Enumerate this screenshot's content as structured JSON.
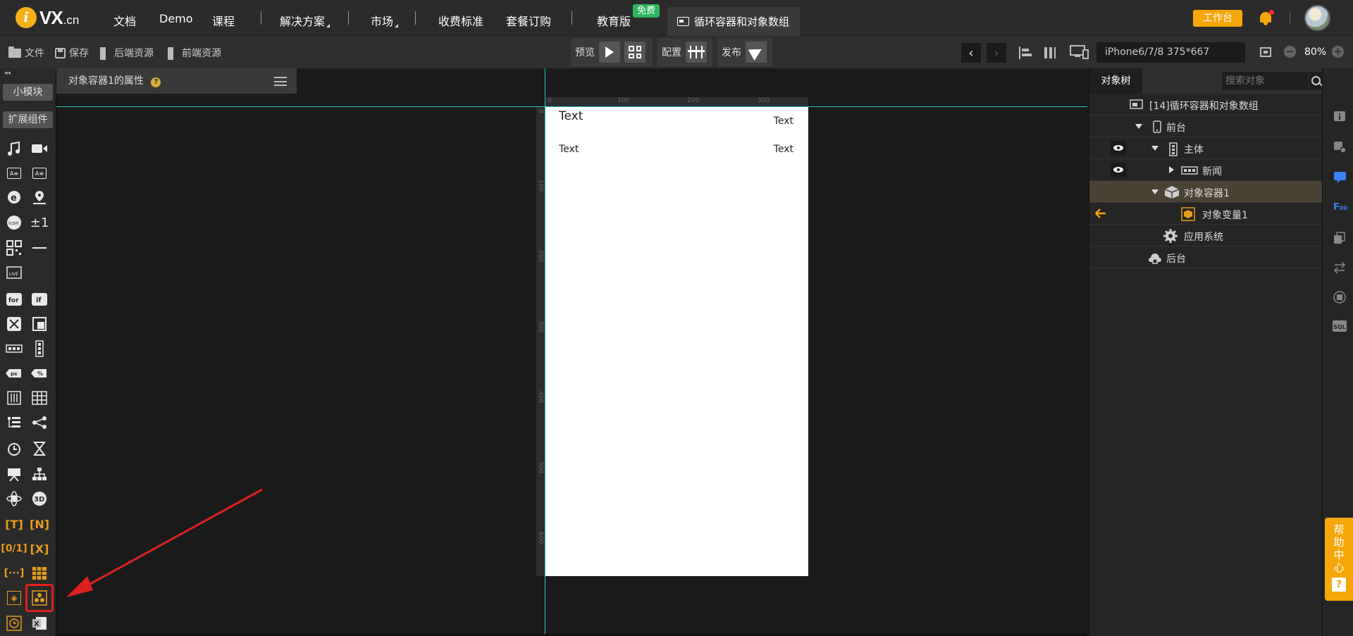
{
  "app": {
    "logo_letter": "i",
    "logo_text": "VX",
    "logo_suffix": ".cn"
  },
  "topnav": {
    "items": [
      "文档",
      "Demo",
      "课程",
      "解决方案",
      "市场",
      "收费标准",
      "套餐订购",
      "教育版"
    ],
    "free_badge": "免费",
    "active_tab": "循环容器和对象数组",
    "work_button": "工作台"
  },
  "toolbar": {
    "file": "文件",
    "save": "保存",
    "backend_res": "后端资源",
    "frontend_res": "前端资源",
    "preview": "预览",
    "config": "配置",
    "publish": "发布",
    "prev_arrow": "‹",
    "next_arrow": "›",
    "device": "iPhone6/7/8 375*667",
    "zoom": "80%",
    "zoom_out": "−",
    "zoom_in": "+"
  },
  "left_panel": {
    "collapse": "◂◂",
    "tab_small": "小模块",
    "tab_ext": "扩展组件"
  },
  "properties": {
    "title": "对象容器1的属性",
    "help": "?"
  },
  "rulers": {
    "top": [
      "0",
      "100",
      "200",
      "300"
    ],
    "left": [
      "0",
      "100",
      "200",
      "300",
      "400",
      "500",
      "600"
    ]
  },
  "phone": {
    "texts": [
      "Text",
      "Text",
      "Text",
      "Text"
    ]
  },
  "object_tree": {
    "tab": "对象树",
    "search_placeholder": "搜索对象",
    "rows": [
      {
        "label": "[14]循环容器和对象数组"
      },
      {
        "label": "前台"
      },
      {
        "label": "主体"
      },
      {
        "label": "新闻"
      },
      {
        "label": "对象容器1"
      },
      {
        "label": "对象变量1"
      },
      {
        "label": "应用系统"
      },
      {
        "label": "后台"
      }
    ]
  },
  "help_center": {
    "label": "帮助中心",
    "q": "?"
  },
  "colors": {
    "accent": "#f6a609",
    "guide": "#2ec6c6",
    "highlight": "#e02020",
    "free": "#2db55d"
  }
}
